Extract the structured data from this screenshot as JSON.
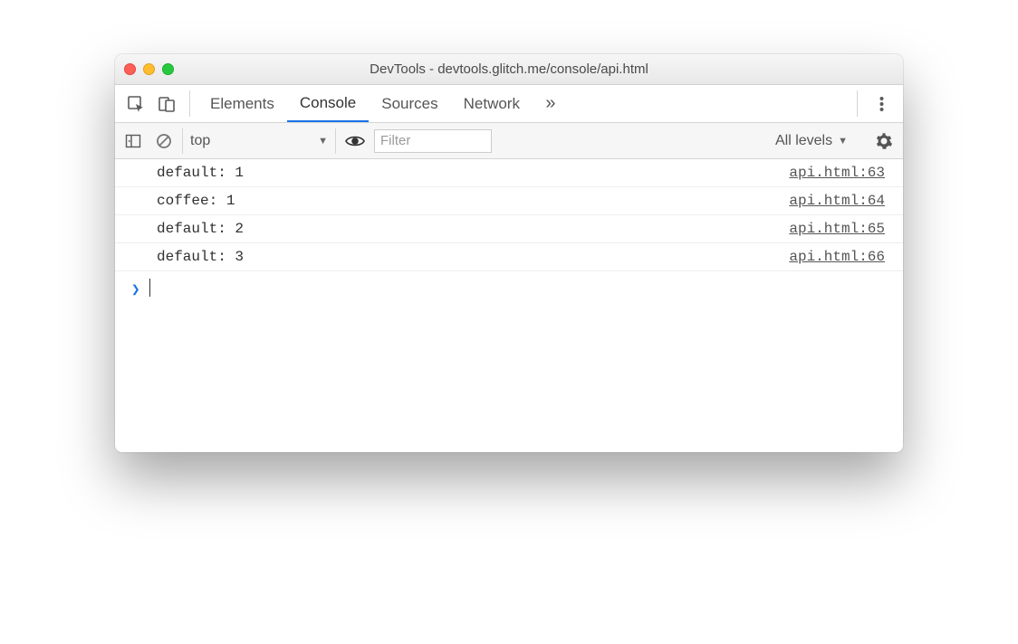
{
  "window": {
    "title": "DevTools - devtools.glitch.me/console/api.html"
  },
  "tabs": {
    "items": [
      "Elements",
      "Console",
      "Sources",
      "Network"
    ],
    "active": "Console",
    "more": "»"
  },
  "toolbar": {
    "context": "top",
    "filter_placeholder": "Filter",
    "levels": "All levels"
  },
  "console": {
    "rows": [
      {
        "text": "default: 1",
        "source": "api.html:63"
      },
      {
        "text": "coffee: 1",
        "source": "api.html:64"
      },
      {
        "text": "default: 2",
        "source": "api.html:65"
      },
      {
        "text": "default: 3",
        "source": "api.html:66"
      }
    ],
    "prompt": "❯"
  }
}
